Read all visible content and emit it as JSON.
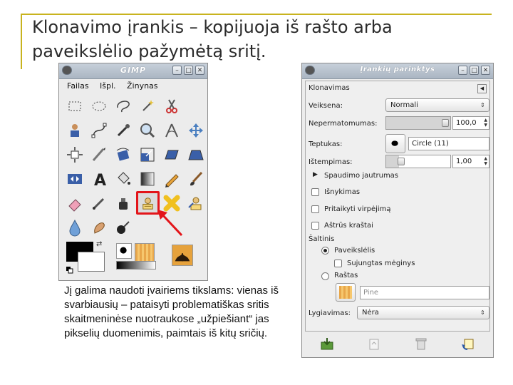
{
  "slide": {
    "title_line1": "Klonavimo įrankis – kopijuoja iš rašto arba",
    "title_line2": "paveikslėlio pažymėtą sritį.",
    "paragraph": [
      "Jį galima naudoti įvairiems tikslams: vienas iš",
      "svarbiausių – pataisyti problematiškas sritis",
      "skaitmeninėse nuotraukose „užpiešiant“ jas",
      "pikselių duomenimis, paimtais iš kitų sričių."
    ],
    "accent_color": "#c8b31e",
    "highlight_color": "#e3151a"
  },
  "toolbox": {
    "title": "GIMP",
    "menu": [
      "Failas",
      "Išpl.",
      "Žinynas"
    ],
    "selected_tool": "clone-tool"
  },
  "options": {
    "title": "Įrankių parinktys",
    "section": "Klonavimas",
    "mode_label": "Veiksena:",
    "mode_value": "Normali",
    "opacity_label": "Nepermatomumas:",
    "opacity_value": "100,0",
    "opacity": 1.0,
    "brush_label": "Teptukas:",
    "brush_value": "Circle (11)",
    "scale_label": "Ištempimas:",
    "scale_value": "1,00",
    "pressure_label": "Spaudimo jautrumas",
    "fade_label": "Išnykimas",
    "jitter_label": "Pritaikyti virpėjimą",
    "hardness_label": "Aštrūs kraštai",
    "source_label": "Šaltinis",
    "source_image": "Paveikslėlis",
    "sample_merged": "Sujungtas mėginys",
    "source_pattern": "Raštas",
    "pattern_value": "Pine",
    "alignment_label": "Lygiavimas:",
    "alignment_value": "Nėra"
  }
}
